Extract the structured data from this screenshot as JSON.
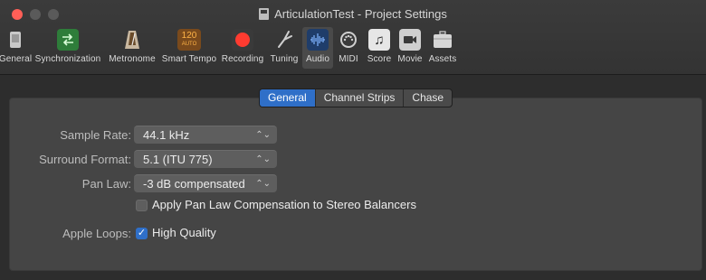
{
  "window": {
    "title": "ArticulationTest - Project Settings"
  },
  "toolbar": {
    "items": [
      {
        "label": "General",
        "icon": "general-icon"
      },
      {
        "label": "Synchronization",
        "icon": "sync-icon"
      },
      {
        "label": "Metronome",
        "icon": "metronome-icon"
      },
      {
        "label": "Smart Tempo",
        "icon": "smart-tempo-icon",
        "badge_top": "120",
        "badge_bottom": "AUTO"
      },
      {
        "label": "Recording",
        "icon": "record-icon"
      },
      {
        "label": "Tuning",
        "icon": "tuning-fork-icon"
      },
      {
        "label": "Audio",
        "icon": "audio-icon",
        "active": true
      },
      {
        "label": "MIDI",
        "icon": "midi-icon"
      },
      {
        "label": "Score",
        "icon": "score-icon"
      },
      {
        "label": "Movie",
        "icon": "movie-icon"
      },
      {
        "label": "Assets",
        "icon": "assets-icon"
      }
    ]
  },
  "tabs": {
    "items": [
      {
        "label": "General",
        "selected": true
      },
      {
        "label": "Channel Strips",
        "selected": false
      },
      {
        "label": "Chase",
        "selected": false
      }
    ]
  },
  "settings": {
    "sample_rate": {
      "label": "Sample Rate:",
      "value": "44.1 kHz"
    },
    "surround_format": {
      "label": "Surround Format:",
      "value": "5.1 (ITU 775)"
    },
    "pan_law": {
      "label": "Pan Law:",
      "value": "-3 dB compensated"
    },
    "pan_law_comp": {
      "label": "Apply Pan Law Compensation to Stereo Balancers",
      "checked": false
    },
    "apple_loops": {
      "label": "Apple Loops:",
      "option": "High Quality",
      "checked": true
    }
  },
  "colors": {
    "accent": "#2f6fc8",
    "record": "#ff3b30"
  }
}
